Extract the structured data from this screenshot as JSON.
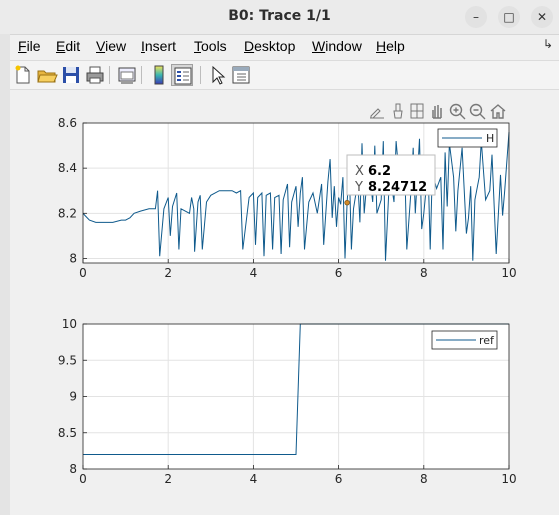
{
  "window": {
    "title": "B0: Trace 1/1",
    "minimize_icon": "minimize-icon",
    "maximize_icon": "maximize-icon",
    "close_icon": "close-icon"
  },
  "menubar": {
    "items": [
      {
        "first": "F",
        "rest": "ile"
      },
      {
        "first": "E",
        "rest": "dit"
      },
      {
        "first": "V",
        "rest": "iew"
      },
      {
        "first": "I",
        "rest": "nsert"
      },
      {
        "first": "T",
        "rest": "ools"
      },
      {
        "first": "D",
        "rest": "esktop"
      },
      {
        "first": "W",
        "rest": "indow"
      },
      {
        "first": "H",
        "rest": "elp"
      }
    ],
    "overflow_icon": "dock-arrow-icon"
  },
  "toolbar": {
    "icons": [
      "new-figure-icon",
      "open-file-icon",
      "save-icon",
      "print-icon",
      "link-plot-icon",
      "colorbar-icon",
      "legend-icon",
      "pointer-icon",
      "property-inspector-icon"
    ]
  },
  "axes_toolbar": {
    "icons": [
      "export-icon",
      "brush-icon",
      "data-tips-icon",
      "pan-icon",
      "zoom-in-icon",
      "zoom-out-icon",
      "home-icon"
    ]
  },
  "datatip": {
    "x_label": "X",
    "x_value": "6.2",
    "y_label": "Y",
    "y_value": "8.24712"
  },
  "chart_data": [
    {
      "type": "line",
      "title": "",
      "xlabel": "",
      "ylabel": "",
      "xlim": [
        0,
        10
      ],
      "ylim": [
        7.98,
        8.6
      ],
      "xticks": [
        "0",
        "2",
        "4",
        "6",
        "8",
        "10"
      ],
      "yticks": [
        "8",
        "8.2",
        "8.4",
        "8.6"
      ],
      "grid": true,
      "legend_position": "top-right",
      "series": [
        {
          "name": "H",
          "color": "#0f5a8c",
          "points": [
            [
              0,
              8.2
            ],
            [
              0.05,
              8.19
            ],
            [
              0.15,
              8.17
            ],
            [
              0.3,
              8.16
            ],
            [
              0.5,
              8.16
            ],
            [
              0.7,
              8.16
            ],
            [
              0.9,
              8.17
            ],
            [
              1.0,
              8.17
            ],
            [
              1.1,
              8.18
            ],
            [
              1.2,
              8.2
            ],
            [
              1.35,
              8.21
            ],
            [
              1.55,
              8.22
            ],
            [
              1.7,
              8.22
            ],
            [
              1.75,
              8.3
            ],
            [
              1.8,
              8.01
            ],
            [
              1.9,
              8.22
            ],
            [
              2.0,
              8.27
            ],
            [
              2.05,
              8.1
            ],
            [
              2.1,
              8.23
            ],
            [
              2.2,
              8.29
            ],
            [
              2.25,
              8.04
            ],
            [
              2.3,
              8.22
            ],
            [
              2.5,
              8.2
            ],
            [
              2.55,
              8.27
            ],
            [
              2.6,
              8.22
            ],
            [
              2.62,
              8.03
            ],
            [
              2.7,
              8.25
            ],
            [
              2.75,
              8.28
            ],
            [
              2.8,
              8.04
            ],
            [
              2.9,
              8.25
            ],
            [
              3.0,
              8.28
            ],
            [
              3.2,
              8.3
            ],
            [
              3.5,
              8.3
            ],
            [
              3.6,
              8.29
            ],
            [
              3.7,
              8.3
            ],
            [
              3.75,
              8.04
            ],
            [
              3.9,
              8.27
            ],
            [
              4.0,
              8.29
            ],
            [
              4.05,
              8.06
            ],
            [
              4.1,
              8.27
            ],
            [
              4.2,
              8.29
            ],
            [
              4.25,
              8.01
            ],
            [
              4.3,
              8.28
            ],
            [
              4.4,
              8.29
            ],
            [
              4.45,
              8.04
            ],
            [
              4.5,
              8.27
            ],
            [
              4.6,
              8.28
            ],
            [
              4.65,
              8.02
            ],
            [
              4.7,
              8.26
            ],
            [
              4.8,
              8.33
            ],
            [
              4.85,
              8.05
            ],
            [
              4.9,
              8.25
            ],
            [
              5.0,
              8.32
            ],
            [
              5.05,
              8.14
            ],
            [
              5.1,
              8.29
            ],
            [
              5.15,
              8.36
            ],
            [
              5.2,
              8.04
            ],
            [
              5.3,
              8.25
            ],
            [
              5.4,
              8.29
            ],
            [
              5.5,
              8.2
            ],
            [
              5.6,
              8.33
            ],
            [
              5.65,
              8.06
            ],
            [
              5.75,
              8.34
            ],
            [
              5.8,
              8.44
            ],
            [
              5.85,
              8.18
            ],
            [
              5.9,
              8.32
            ],
            [
              5.95,
              8.14
            ],
            [
              6.0,
              8.27
            ],
            [
              6.05,
              8.24
            ],
            [
              6.1,
              8.36
            ],
            [
              6.15,
              8.0
            ],
            [
              6.2,
              8.24712
            ],
            [
              6.25,
              8.4
            ],
            [
              6.3,
              8.04
            ],
            [
              6.35,
              8.22
            ],
            [
              6.45,
              8.34
            ],
            [
              6.5,
              8.16
            ],
            [
              6.55,
              8.51
            ],
            [
              6.6,
              8.2
            ],
            [
              6.7,
              8.42
            ],
            [
              6.8,
              8.25
            ],
            [
              6.85,
              8.5
            ],
            [
              6.9,
              8.2
            ],
            [
              7.0,
              8.26
            ],
            [
              7.05,
              8.52
            ],
            [
              7.1,
              7.99
            ],
            [
              7.2,
              8.38
            ],
            [
              7.3,
              8.25
            ],
            [
              7.35,
              8.52
            ],
            [
              7.45,
              8.3
            ],
            [
              7.55,
              8.43
            ],
            [
              7.6,
              8.04
            ],
            [
              7.7,
              8.3
            ],
            [
              7.75,
              8.49
            ],
            [
              7.8,
              8.2
            ],
            [
              7.9,
              8.53
            ],
            [
              7.95,
              8.13
            ],
            [
              8.0,
              8.2
            ],
            [
              8.1,
              8.4
            ],
            [
              8.15,
              8.04
            ],
            [
              8.2,
              8.38
            ],
            [
              8.3,
              8.31
            ],
            [
              8.4,
              8.36
            ],
            [
              8.45,
              8.04
            ],
            [
              8.5,
              8.47
            ],
            [
              8.55,
              8.23
            ],
            [
              8.6,
              8.51
            ],
            [
              8.7,
              8.36
            ],
            [
              8.75,
              8.12
            ],
            [
              8.8,
              8.3
            ],
            [
              8.9,
              8.49
            ],
            [
              9.0,
              8.11
            ],
            [
              9.05,
              8.18
            ],
            [
              9.1,
              8.32
            ],
            [
              9.15,
              7.99
            ],
            [
              9.2,
              8.26
            ],
            [
              9.3,
              8.36
            ],
            [
              9.35,
              8.52
            ],
            [
              9.45,
              8.26
            ],
            [
              9.55,
              8.3
            ],
            [
              9.6,
              8.46
            ],
            [
              9.7,
              8.02
            ],
            [
              9.8,
              8.37
            ],
            [
              9.85,
              8.19
            ],
            [
              9.9,
              8.3
            ],
            [
              10.0,
              8.56
            ]
          ]
        }
      ]
    },
    {
      "type": "line",
      "title": "",
      "xlabel": "",
      "ylabel": "",
      "xlim": [
        0,
        10
      ],
      "ylim": [
        8,
        10
      ],
      "xticks": [
        "0",
        "2",
        "4",
        "6",
        "8",
        "10"
      ],
      "yticks": [
        "8",
        "8.5",
        "9",
        "9.5",
        "10"
      ],
      "grid": true,
      "legend_position": "top-right",
      "series": [
        {
          "name": "ref",
          "color": "#0f5a8c",
          "points": [
            [
              0,
              8.2
            ],
            [
              5.0,
              8.2
            ],
            [
              5.1,
              10
            ],
            [
              10,
              10
            ]
          ]
        }
      ]
    }
  ]
}
